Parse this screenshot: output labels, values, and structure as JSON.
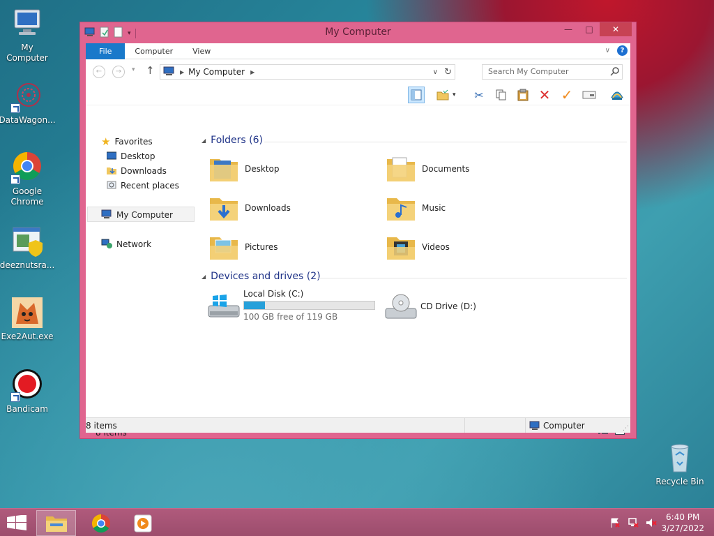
{
  "desktop": {
    "icons": [
      {
        "label": "My Computer"
      },
      {
        "label": "DataWagon..."
      },
      {
        "label": "Google Chrome"
      },
      {
        "label": "deeznutsra..."
      },
      {
        "label": "Exe2Aut.exe"
      },
      {
        "label": "Bandicam"
      },
      {
        "label": "Recycle Bin"
      }
    ]
  },
  "window": {
    "title": "My Computer",
    "tabs": [
      "File",
      "Computer",
      "View"
    ],
    "address": "My Computer",
    "search_placeholder": "Search My Computer",
    "nav": {
      "favorites": "Favorites",
      "desktop": "Desktop",
      "downloads": "Downloads",
      "recent": "Recent places",
      "computer": "My Computer",
      "network": "Network"
    },
    "folders_header": "Folders (6)",
    "folders": [
      "Desktop",
      "Documents",
      "Downloads",
      "Music",
      "Pictures",
      "Videos"
    ],
    "devices_header": "Devices and drives (2)",
    "drives": {
      "c_name": "Local Disk (C:)",
      "c_free": "100 GB free of 119 GB",
      "c_used_fraction": 0.16,
      "d_name": "CD Drive (D:)"
    },
    "status_inner": "8 items",
    "status_bar_left": "8 items",
    "status_bar_right": "Computer"
  },
  "taskbar": {
    "time": "6:40 PM",
    "date": "3/27/2022"
  },
  "colors": {
    "window_frame": "#e0658f",
    "accent": "#1979ca",
    "close": "#c74254",
    "group_heading": "#1e3287"
  }
}
